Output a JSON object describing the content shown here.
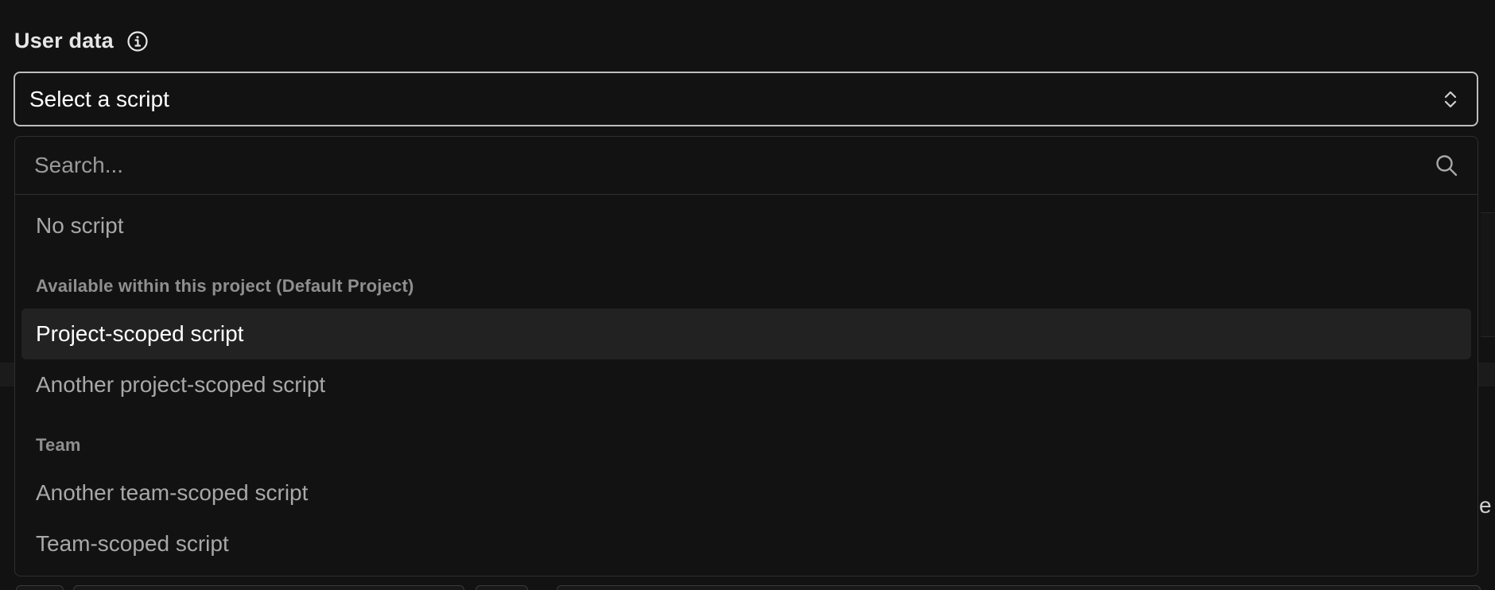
{
  "field": {
    "label": "User data",
    "info_icon": "info-icon"
  },
  "select": {
    "value": "Select a script",
    "icon": "chevrons-up-down-icon"
  },
  "dropdown": {
    "search": {
      "placeholder": "Search...",
      "value": "",
      "icon": "search-icon"
    },
    "no_script_label": "No script",
    "groups": [
      {
        "heading": "Available within this project (Default Project)",
        "items": [
          {
            "label": "Project-scoped script",
            "highlighted": true
          },
          {
            "label": "Another project-scoped script",
            "highlighted": false
          }
        ]
      },
      {
        "heading": "Team",
        "items": [
          {
            "label": "Another team-scoped script",
            "highlighted": false
          },
          {
            "label": "Team-scoped script",
            "highlighted": false
          }
        ]
      }
    ]
  },
  "background": {
    "partial_text": "e"
  },
  "colors": {
    "background": "#121212",
    "border_active": "#bdbdbd",
    "highlight": "#222222",
    "muted_text": "#a8a8a8"
  }
}
